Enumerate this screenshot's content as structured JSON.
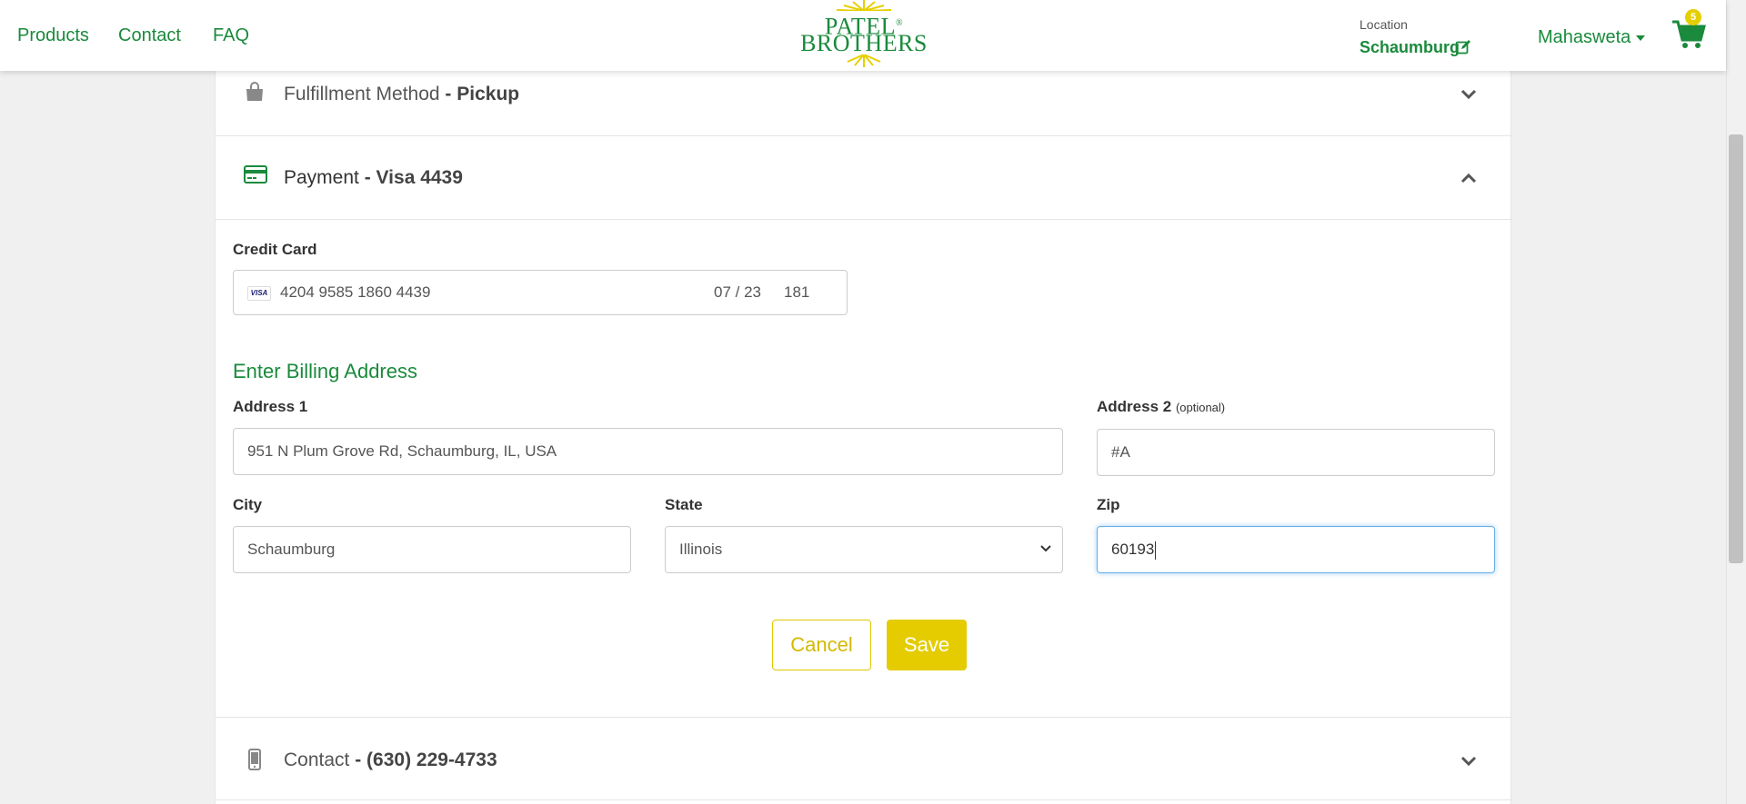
{
  "header": {
    "nav": [
      "Products",
      "Contact",
      "FAQ"
    ],
    "logo": {
      "line1": "PATEL",
      "reg": "®",
      "line2": "BROTHERS"
    },
    "location_label": "Location",
    "location_value": "Schaumburg",
    "user_name": "Mahasweta",
    "cart_count": "5"
  },
  "sections": {
    "fulfillment": {
      "label": "Fulfillment Method",
      "value": "- Pickup"
    },
    "payment": {
      "label": "Payment",
      "value": "- Visa 4439"
    },
    "contact": {
      "label": "Contact",
      "value": "- (630) 229-4733"
    }
  },
  "payment_form": {
    "credit_card_label": "Credit Card",
    "card_brand": "VISA",
    "card_number": "4204 9585 1860 4439",
    "card_expiry": "07 / 23",
    "card_cvc": "181",
    "billing_title": "Enter Billing Address",
    "address1_label": "Address 1",
    "address1_value": "951 N Plum Grove Rd, Schaumburg, IL, USA",
    "address2_label": "Address 2",
    "address2_optional": "(optional)",
    "address2_value": "#A",
    "city_label": "City",
    "city_value": "Schaumburg",
    "state_label": "State",
    "state_value": "Illinois",
    "zip_label": "Zip",
    "zip_value": "60193",
    "cancel_label": "Cancel",
    "save_label": "Save"
  },
  "colors": {
    "brand_green": "#1a8a3c",
    "accent_yellow": "#e4cc00",
    "focus_blue": "#66afe9"
  },
  "icons": [
    "shopping-bag-icon",
    "credit-card-icon",
    "mobile-phone-icon",
    "chevron-down-icon",
    "chevron-up-icon",
    "edit-icon",
    "cart-icon"
  ]
}
